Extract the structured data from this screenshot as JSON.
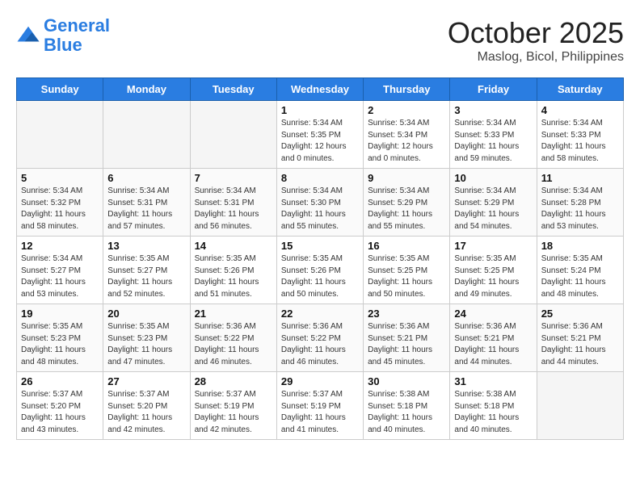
{
  "header": {
    "logo_line1": "General",
    "logo_line2": "Blue",
    "month": "October 2025",
    "location": "Maslog, Bicol, Philippines"
  },
  "days_of_week": [
    "Sunday",
    "Monday",
    "Tuesday",
    "Wednesday",
    "Thursday",
    "Friday",
    "Saturday"
  ],
  "weeks": [
    [
      {
        "day": "",
        "empty": true
      },
      {
        "day": "",
        "empty": true
      },
      {
        "day": "",
        "empty": true
      },
      {
        "day": "1",
        "sunrise": "Sunrise: 5:34 AM",
        "sunset": "Sunset: 5:35 PM",
        "daylight": "Daylight: 12 hours and 0 minutes."
      },
      {
        "day": "2",
        "sunrise": "Sunrise: 5:34 AM",
        "sunset": "Sunset: 5:34 PM",
        "daylight": "Daylight: 12 hours and 0 minutes."
      },
      {
        "day": "3",
        "sunrise": "Sunrise: 5:34 AM",
        "sunset": "Sunset: 5:33 PM",
        "daylight": "Daylight: 11 hours and 59 minutes."
      },
      {
        "day": "4",
        "sunrise": "Sunrise: 5:34 AM",
        "sunset": "Sunset: 5:33 PM",
        "daylight": "Daylight: 11 hours and 58 minutes."
      }
    ],
    [
      {
        "day": "5",
        "sunrise": "Sunrise: 5:34 AM",
        "sunset": "Sunset: 5:32 PM",
        "daylight": "Daylight: 11 hours and 58 minutes."
      },
      {
        "day": "6",
        "sunrise": "Sunrise: 5:34 AM",
        "sunset": "Sunset: 5:31 PM",
        "daylight": "Daylight: 11 hours and 57 minutes."
      },
      {
        "day": "7",
        "sunrise": "Sunrise: 5:34 AM",
        "sunset": "Sunset: 5:31 PM",
        "daylight": "Daylight: 11 hours and 56 minutes."
      },
      {
        "day": "8",
        "sunrise": "Sunrise: 5:34 AM",
        "sunset": "Sunset: 5:30 PM",
        "daylight": "Daylight: 11 hours and 55 minutes."
      },
      {
        "day": "9",
        "sunrise": "Sunrise: 5:34 AM",
        "sunset": "Sunset: 5:29 PM",
        "daylight": "Daylight: 11 hours and 55 minutes."
      },
      {
        "day": "10",
        "sunrise": "Sunrise: 5:34 AM",
        "sunset": "Sunset: 5:29 PM",
        "daylight": "Daylight: 11 hours and 54 minutes."
      },
      {
        "day": "11",
        "sunrise": "Sunrise: 5:34 AM",
        "sunset": "Sunset: 5:28 PM",
        "daylight": "Daylight: 11 hours and 53 minutes."
      }
    ],
    [
      {
        "day": "12",
        "sunrise": "Sunrise: 5:34 AM",
        "sunset": "Sunset: 5:27 PM",
        "daylight": "Daylight: 11 hours and 53 minutes."
      },
      {
        "day": "13",
        "sunrise": "Sunrise: 5:35 AM",
        "sunset": "Sunset: 5:27 PM",
        "daylight": "Daylight: 11 hours and 52 minutes."
      },
      {
        "day": "14",
        "sunrise": "Sunrise: 5:35 AM",
        "sunset": "Sunset: 5:26 PM",
        "daylight": "Daylight: 11 hours and 51 minutes."
      },
      {
        "day": "15",
        "sunrise": "Sunrise: 5:35 AM",
        "sunset": "Sunset: 5:26 PM",
        "daylight": "Daylight: 11 hours and 50 minutes."
      },
      {
        "day": "16",
        "sunrise": "Sunrise: 5:35 AM",
        "sunset": "Sunset: 5:25 PM",
        "daylight": "Daylight: 11 hours and 50 minutes."
      },
      {
        "day": "17",
        "sunrise": "Sunrise: 5:35 AM",
        "sunset": "Sunset: 5:25 PM",
        "daylight": "Daylight: 11 hours and 49 minutes."
      },
      {
        "day": "18",
        "sunrise": "Sunrise: 5:35 AM",
        "sunset": "Sunset: 5:24 PM",
        "daylight": "Daylight: 11 hours and 48 minutes."
      }
    ],
    [
      {
        "day": "19",
        "sunrise": "Sunrise: 5:35 AM",
        "sunset": "Sunset: 5:23 PM",
        "daylight": "Daylight: 11 hours and 48 minutes."
      },
      {
        "day": "20",
        "sunrise": "Sunrise: 5:35 AM",
        "sunset": "Sunset: 5:23 PM",
        "daylight": "Daylight: 11 hours and 47 minutes."
      },
      {
        "day": "21",
        "sunrise": "Sunrise: 5:36 AM",
        "sunset": "Sunset: 5:22 PM",
        "daylight": "Daylight: 11 hours and 46 minutes."
      },
      {
        "day": "22",
        "sunrise": "Sunrise: 5:36 AM",
        "sunset": "Sunset: 5:22 PM",
        "daylight": "Daylight: 11 hours and 46 minutes."
      },
      {
        "day": "23",
        "sunrise": "Sunrise: 5:36 AM",
        "sunset": "Sunset: 5:21 PM",
        "daylight": "Daylight: 11 hours and 45 minutes."
      },
      {
        "day": "24",
        "sunrise": "Sunrise: 5:36 AM",
        "sunset": "Sunset: 5:21 PM",
        "daylight": "Daylight: 11 hours and 44 minutes."
      },
      {
        "day": "25",
        "sunrise": "Sunrise: 5:36 AM",
        "sunset": "Sunset: 5:21 PM",
        "daylight": "Daylight: 11 hours and 44 minutes."
      }
    ],
    [
      {
        "day": "26",
        "sunrise": "Sunrise: 5:37 AM",
        "sunset": "Sunset: 5:20 PM",
        "daylight": "Daylight: 11 hours and 43 minutes."
      },
      {
        "day": "27",
        "sunrise": "Sunrise: 5:37 AM",
        "sunset": "Sunset: 5:20 PM",
        "daylight": "Daylight: 11 hours and 42 minutes."
      },
      {
        "day": "28",
        "sunrise": "Sunrise: 5:37 AM",
        "sunset": "Sunset: 5:19 PM",
        "daylight": "Daylight: 11 hours and 42 minutes."
      },
      {
        "day": "29",
        "sunrise": "Sunrise: 5:37 AM",
        "sunset": "Sunset: 5:19 PM",
        "daylight": "Daylight: 11 hours and 41 minutes."
      },
      {
        "day": "30",
        "sunrise": "Sunrise: 5:38 AM",
        "sunset": "Sunset: 5:18 PM",
        "daylight": "Daylight: 11 hours and 40 minutes."
      },
      {
        "day": "31",
        "sunrise": "Sunrise: 5:38 AM",
        "sunset": "Sunset: 5:18 PM",
        "daylight": "Daylight: 11 hours and 40 minutes."
      },
      {
        "day": "",
        "empty": true
      }
    ]
  ]
}
